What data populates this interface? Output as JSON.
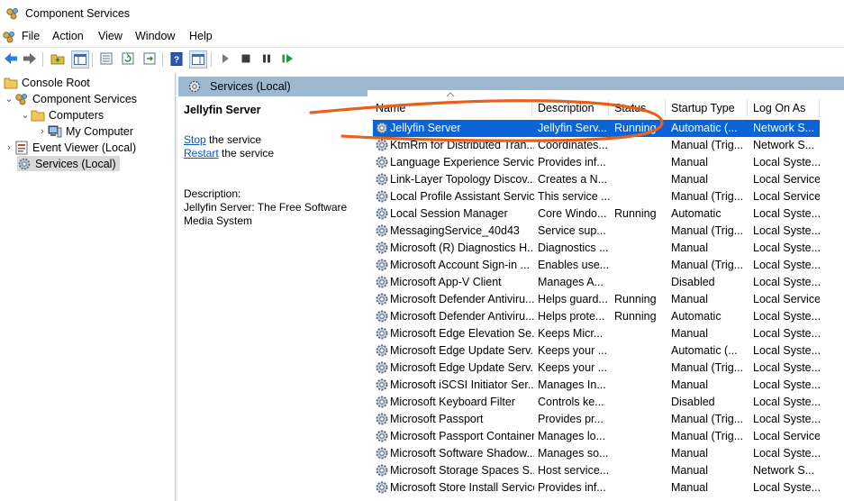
{
  "window": {
    "title": "Component Services"
  },
  "menu": [
    "File",
    "Action",
    "View",
    "Window",
    "Help"
  ],
  "toolbar": [
    "back-icon",
    "forward-icon",
    "up-folder-icon",
    "show-hide-tree-icon",
    "properties-icon",
    "refresh-icon",
    "export-icon",
    "help-icon",
    "action-pane-icon",
    "play-icon",
    "stop-icon",
    "pause-icon",
    "resume-icon"
  ],
  "tree": {
    "items": [
      {
        "label": "Console Root",
        "icon": "folder-icon"
      },
      {
        "label": "Component Services",
        "icon": "component-services-icon"
      },
      {
        "label": "Computers",
        "icon": "folder-icon"
      },
      {
        "label": "My Computer",
        "icon": "computer-icon"
      },
      {
        "label": "Event Viewer (Local)",
        "icon": "event-viewer-icon"
      },
      {
        "label": "Services (Local)",
        "icon": "services-icon"
      }
    ]
  },
  "header": {
    "title": "Services (Local)"
  },
  "details": {
    "service_name": "Jellyfin Server",
    "stop_link": "Stop",
    "stop_suffix": " the service",
    "restart_link": "Restart",
    "restart_suffix": " the service",
    "description_label": "Description:",
    "description_text": "Jellyfin Server: The Free Software Media System"
  },
  "columns": [
    "Name",
    "Description",
    "Status",
    "Startup Type",
    "Log On As"
  ],
  "services": [
    [
      "Jellyfin Server",
      "Jellyfin Serv...",
      "Running",
      "Automatic (...",
      "Network S..."
    ],
    [
      "KtmRm for Distributed Tran...",
      "Coordinates...",
      "",
      "Manual (Trig...",
      "Network S..."
    ],
    [
      "Language Experience Service",
      "Provides inf...",
      "",
      "Manual",
      "Local Syste..."
    ],
    [
      "Link-Layer Topology Discov...",
      "Creates a N...",
      "",
      "Manual",
      "Local Service"
    ],
    [
      "Local Profile Assistant Service",
      "This service ...",
      "",
      "Manual (Trig...",
      "Local Service"
    ],
    [
      "Local Session Manager",
      "Core Windo...",
      "Running",
      "Automatic",
      "Local Syste..."
    ],
    [
      "MessagingService_40d43",
      "Service sup...",
      "",
      "Manual (Trig...",
      "Local Syste..."
    ],
    [
      "Microsoft (R) Diagnostics H...",
      "Diagnostics ...",
      "",
      "Manual",
      "Local Syste..."
    ],
    [
      "Microsoft Account Sign-in ...",
      "Enables use...",
      "",
      "Manual (Trig...",
      "Local Syste..."
    ],
    [
      "Microsoft App-V Client",
      "Manages A...",
      "",
      "Disabled",
      "Local Syste..."
    ],
    [
      "Microsoft Defender Antiviru...",
      "Helps guard...",
      "Running",
      "Manual",
      "Local Service"
    ],
    [
      "Microsoft Defender Antiviru...",
      "Helps prote...",
      "Running",
      "Automatic",
      "Local Syste..."
    ],
    [
      "Microsoft Edge Elevation Se...",
      "Keeps Micr...",
      "",
      "Manual",
      "Local Syste..."
    ],
    [
      "Microsoft Edge Update Serv...",
      "Keeps your ...",
      "",
      "Automatic (...",
      "Local Syste..."
    ],
    [
      "Microsoft Edge Update Serv...",
      "Keeps your ...",
      "",
      "Manual (Trig...",
      "Local Syste..."
    ],
    [
      "Microsoft iSCSI Initiator Ser...",
      "Manages In...",
      "",
      "Manual",
      "Local Syste..."
    ],
    [
      "Microsoft Keyboard Filter",
      "Controls ke...",
      "",
      "Disabled",
      "Local Syste..."
    ],
    [
      "Microsoft Passport",
      "Provides pr...",
      "",
      "Manual (Trig...",
      "Local Syste..."
    ],
    [
      "Microsoft Passport Container",
      "Manages lo...",
      "",
      "Manual (Trig...",
      "Local Service"
    ],
    [
      "Microsoft Software Shadow...",
      "Manages so...",
      "",
      "Manual",
      "Local Syste..."
    ],
    [
      "Microsoft Storage Spaces S...",
      "Host service...",
      "",
      "Manual",
      "Network S..."
    ],
    [
      "Microsoft Store Install Service",
      "Provides inf...",
      "",
      "Manual",
      "Local Syste..."
    ]
  ],
  "colors": {
    "selection": "#0a64d8",
    "header_bar": "#9db9d2",
    "annotation": "#e8601c",
    "link": "#0b58b8"
  }
}
